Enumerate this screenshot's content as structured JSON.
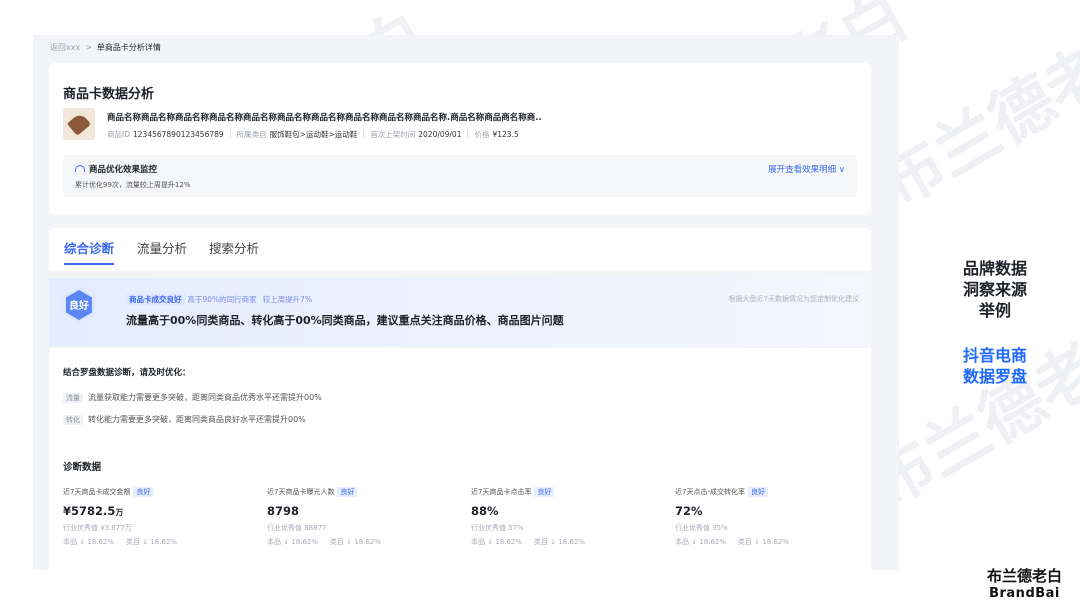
{
  "breadcrumb": {
    "back": "返回xxx",
    "separator": ">",
    "current": "单商品卡分析详情"
  },
  "product_card": {
    "title": "商品卡数据分析",
    "product_name": "商品名称商品名称商品名称商品名称商品名称商品名称商品名称商品名称商品名称商品名称.商品名称商品商名称商..",
    "meta": [
      {
        "label": "商品ID",
        "value": "1234567890123456789"
      },
      {
        "label": "所属类目",
        "value": "服饰鞋包>运动鞋>运动鞋"
      },
      {
        "label": "首次上架时间",
        "value": "2020/09/01"
      },
      {
        "label": "价格",
        "value": "¥123.5"
      }
    ]
  },
  "monitor": {
    "title": "商品优化效果监控",
    "subtitle": "累计优化99次，流量较上周提升12%",
    "expand_link": "展开查看效果明细 ∨"
  },
  "tabs": [
    {
      "label": "综合诊断"
    },
    {
      "label": "流量分析"
    },
    {
      "label": "搜索分析"
    }
  ],
  "banner": {
    "badge": "良好",
    "tag": "商品卡成交良好",
    "line1": "高于90%的同行商家",
    "line1b": "较上周提升7%",
    "right_note": "根据大盘近7天数据情况为您定制优化建议",
    "headline": "流量高于00%同类商品、转化高于00%同类商品，建议重点关注商品价格、商品图片问题"
  },
  "suggestions": {
    "title": "结合罗盘数据诊断，请及时优化：",
    "items": [
      {
        "tag": "流量",
        "text": "流量获取能力需要更多突破，距离同类商品优秀水平还需提升00%"
      },
      {
        "tag": "转化",
        "text": "转化能力需要更多突破，距离同类商品良好水平还需提升00%"
      }
    ]
  },
  "diagnosis": {
    "title": "诊断数据",
    "metrics": [
      {
        "label": "近7天商品卡成交金额",
        "badge": "良好",
        "value": "¥5782.5",
        "unit": "万",
        "industry": "行业优秀值 ¥3,877万",
        "self": "本品 ↓ 18.62%",
        "category": "类目 ↓ 18.62%"
      },
      {
        "label": "近7天商品卡曝光人数",
        "badge": "良好",
        "value": "8798",
        "unit": "",
        "industry": "行业优秀值 88877",
        "self": "本品 ↓ 18.62%",
        "category": "类目 ↓ 18.62%"
      },
      {
        "label": "近7天商品卡点击率",
        "badge": "良好",
        "value": "88%",
        "unit": "",
        "industry": "行业优秀值 57%",
        "self": "本品 ↓ 18.62%",
        "category": "类目 ↓ 18.62%"
      },
      {
        "label": "近7天点击-成交转化率",
        "badge": "良好",
        "value": "72%",
        "unit": "",
        "industry": "行业优秀值 35%",
        "self": "本品 ↓ 18.62%",
        "category": "类目 ↓ 18.62%"
      }
    ]
  },
  "sidebar": {
    "line1": "品牌数据",
    "line2": "洞察来源",
    "line3": "举例",
    "line4": "抖音电商",
    "line5": "数据罗盘"
  },
  "brand": {
    "cn": "布兰德老白",
    "en": "BrandBai"
  },
  "watermark": "布兰德老白",
  "colors": {
    "accent": "#3c6bf0",
    "side_accent": "#1f6bff",
    "badge_hex": "#5b86f5"
  }
}
